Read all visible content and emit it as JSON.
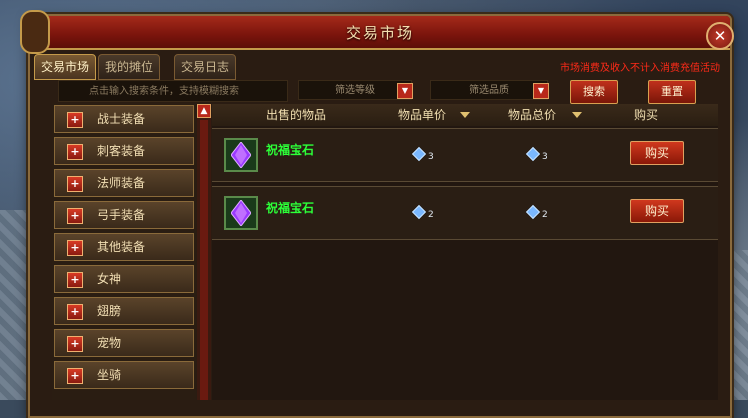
{
  "window": {
    "title": "交易市场"
  },
  "tabs": [
    {
      "label": "交易市场"
    },
    {
      "label": "我的摊位"
    },
    {
      "label": "交易日志"
    }
  ],
  "notice": "市场消费及收入不计入消费充值活动",
  "search": {
    "placeholder": "点击输入搜索条件，支持模糊搜索",
    "level_filter": "筛选等级",
    "quality_filter": "筛选品质",
    "search_button": "搜索",
    "reset_button": "重置"
  },
  "categories": [
    {
      "label": "战士装备"
    },
    {
      "label": "刺客装备"
    },
    {
      "label": "法师装备"
    },
    {
      "label": "弓手装备"
    },
    {
      "label": "其他装备"
    },
    {
      "label": "女神"
    },
    {
      "label": "翅膀"
    },
    {
      "label": "宠物"
    },
    {
      "label": "坐骑"
    }
  ],
  "table": {
    "columns": [
      "出售的物品",
      "物品单价",
      "物品总价",
      "购买"
    ],
    "rows": [
      {
        "name": "祝福宝石",
        "unit_price": "3",
        "total_price": "3",
        "buy_label": "购买"
      },
      {
        "name": "祝福宝石",
        "unit_price": "2",
        "total_price": "2",
        "buy_label": "购买"
      }
    ]
  },
  "icons": {
    "close": "close-icon",
    "plus": "plus-icon",
    "sort": "sort-down-icon",
    "diamond": "diamond-currency-icon",
    "gem": "purple-gem-icon"
  },
  "colors": {
    "accent_red": "#b8281a",
    "gold_border": "#c49a4a",
    "item_green": "#2cff38",
    "notice_red": "#ff2a18"
  }
}
